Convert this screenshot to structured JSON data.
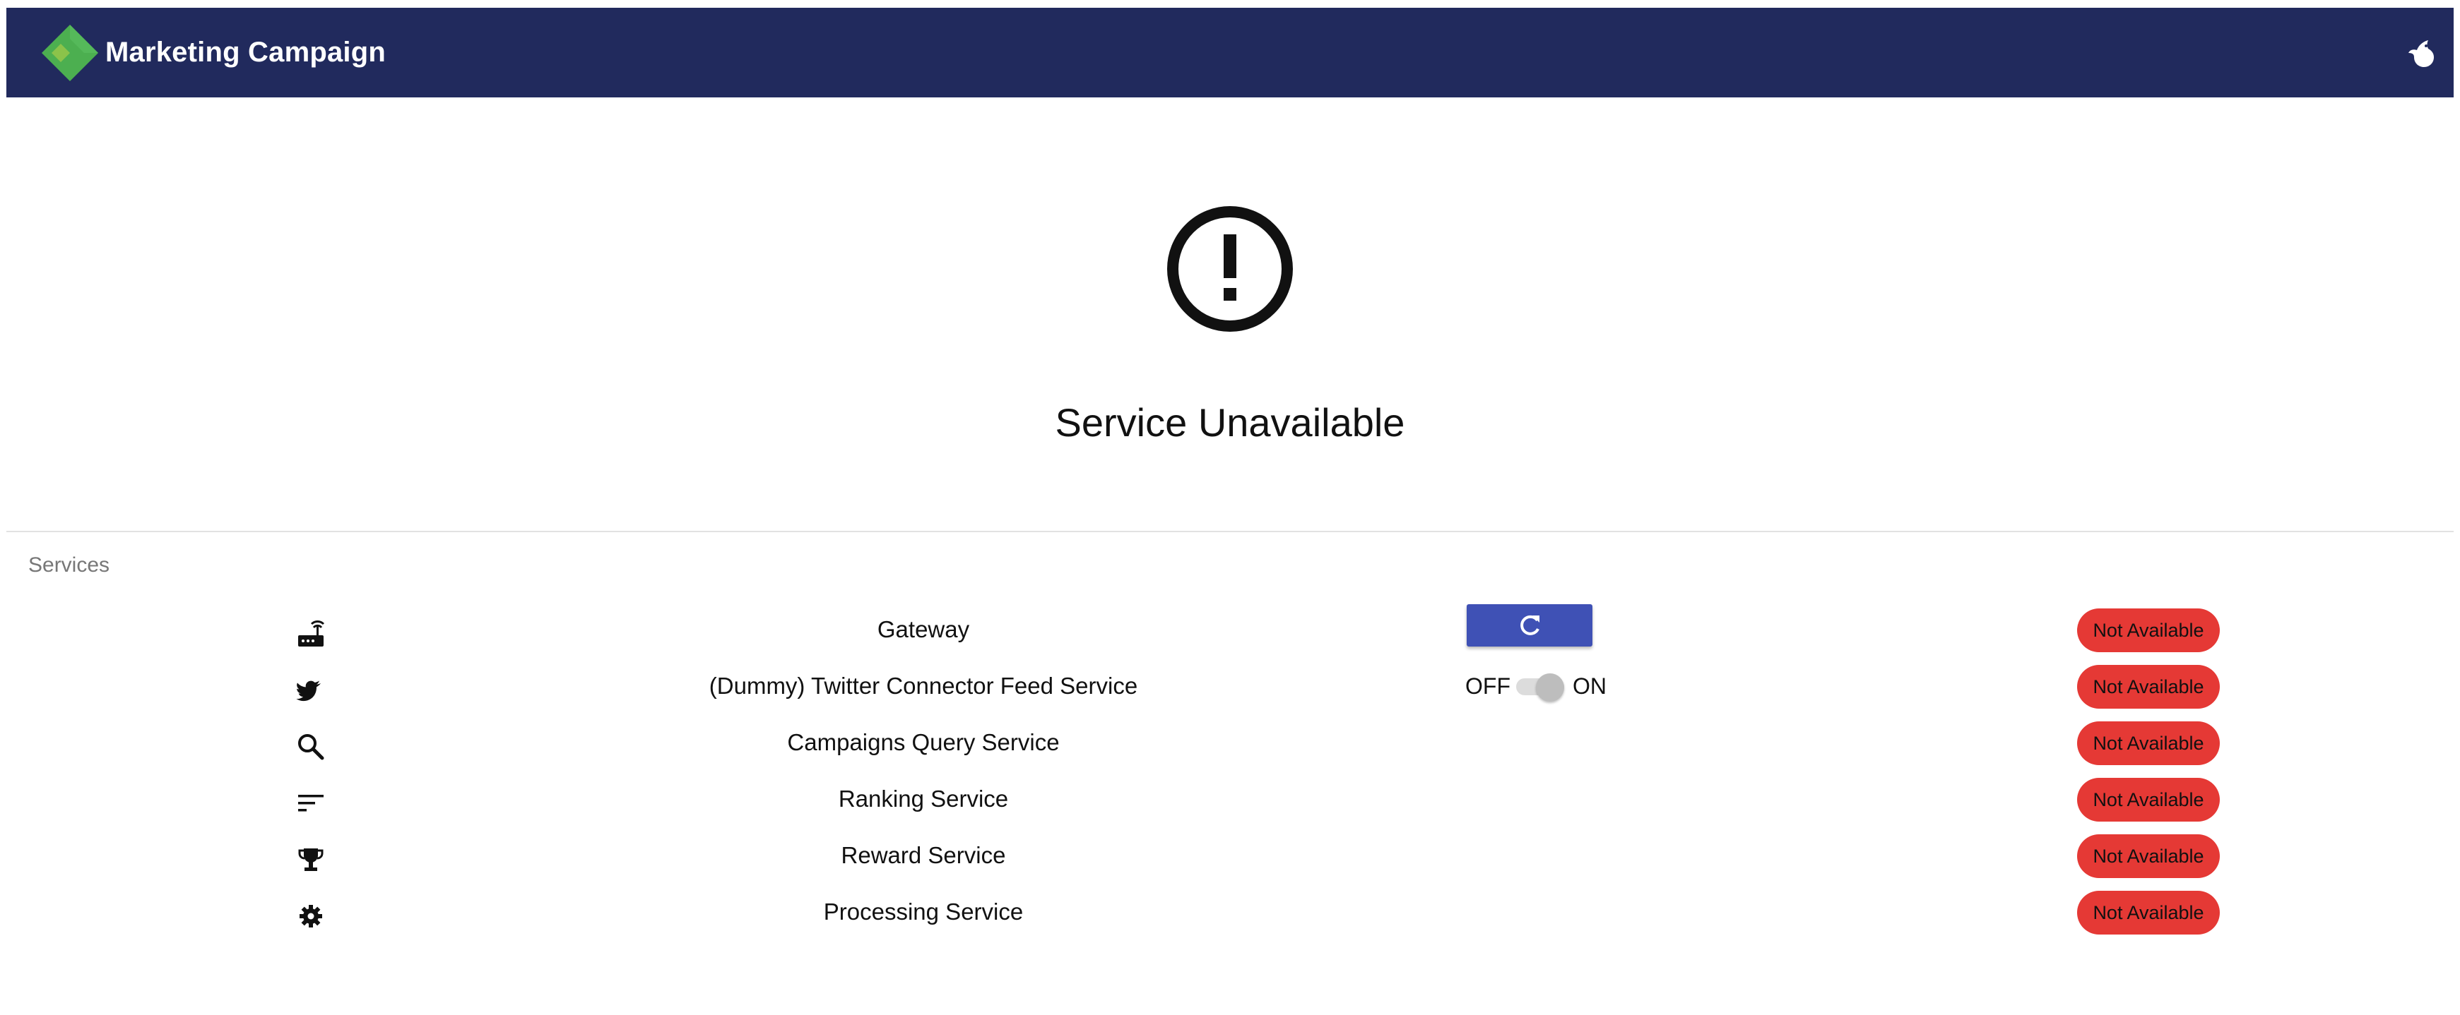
{
  "header": {
    "title": "Marketing Campaign",
    "logo_icon": "diamond-logo",
    "right_icon": "bird-icon",
    "background_color": "#212a5d"
  },
  "error": {
    "icon": "exclamation-circle-icon",
    "title": "Service Unavailable"
  },
  "services": {
    "section_label": "Services",
    "status_color": "#e53935",
    "refresh_button_color": "#3f51b5",
    "items": [
      {
        "icon": "router-icon",
        "name": "Gateway",
        "control": "refresh-button",
        "status": "Not Available"
      },
      {
        "icon": "twitter-bird-icon",
        "name": "(Dummy) Twitter Connector Feed Service",
        "control": "toggle",
        "status": "Not Available"
      },
      {
        "icon": "search-icon",
        "name": "Campaigns Query Service",
        "control": "",
        "status": "Not Available"
      },
      {
        "icon": "sort-icon",
        "name": "Ranking Service",
        "control": "",
        "status": "Not Available"
      },
      {
        "icon": "trophy-icon",
        "name": "Reward Service",
        "control": "",
        "status": "Not Available"
      },
      {
        "icon": "gear-icon",
        "name": "Processing Service",
        "control": "",
        "status": "Not Available"
      }
    ],
    "toggle": {
      "off_label": "OFF",
      "on_label": "ON",
      "state": "off"
    }
  }
}
